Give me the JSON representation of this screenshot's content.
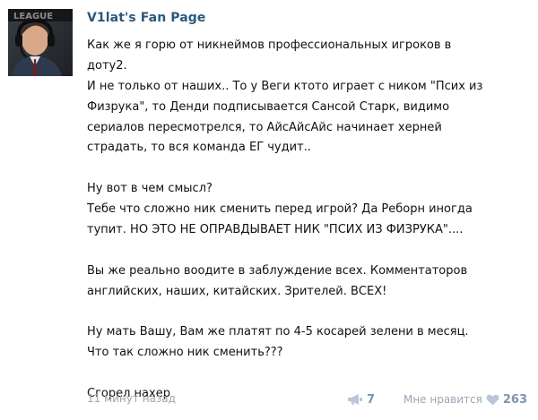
{
  "post": {
    "author": "V1lat's Fan Page",
    "paragraphs": [
      [
        "Как же я горю от никнеймов профессиональных игроков в",
        "доту2.",
        "И не только от наших.. То у Веги ктото играет с ником \"Псих из",
        "Физрука\", то Денди подписывается Сансой Старк, видимо",
        "сериалов пересмотрелся, то АйсАйсАйс начинает херней",
        "страдать, то вся команда ЕГ чудит.."
      ],
      [
        "Ну вот в чем смысл?",
        "Тебе что сложно ник сменить перед игрой? Да Реборн иногда",
        "тупит. НО ЭТО НЕ ОПРАВДЫВАЕТ НИК \"ПСИХ ИЗ ФИЗРУКА\"...."
      ],
      [
        "Вы же реально воодите в заблуждение всех. Комментаторов",
        "английских, наших, китайских. Зрителей. ВСЕХ!"
      ],
      [
        "Ну мать Вашу, Вам же платят по 4-5 косарей зелени в месяц.",
        "Что так сложно ник сменить???"
      ],
      [
        "Сгорел нахер"
      ]
    ],
    "footer": {
      "timestamp": "11 минут назад",
      "share_icon": "megaphone-icon",
      "share_count": "7",
      "like_label": "Мне нравится",
      "like_icon": "heart-icon",
      "like_count": "263"
    },
    "colors": {
      "author": "#2b587a",
      "counter": "#7e95ae",
      "muted": "#a4a4a4",
      "icon": "#b8c6d6"
    }
  }
}
